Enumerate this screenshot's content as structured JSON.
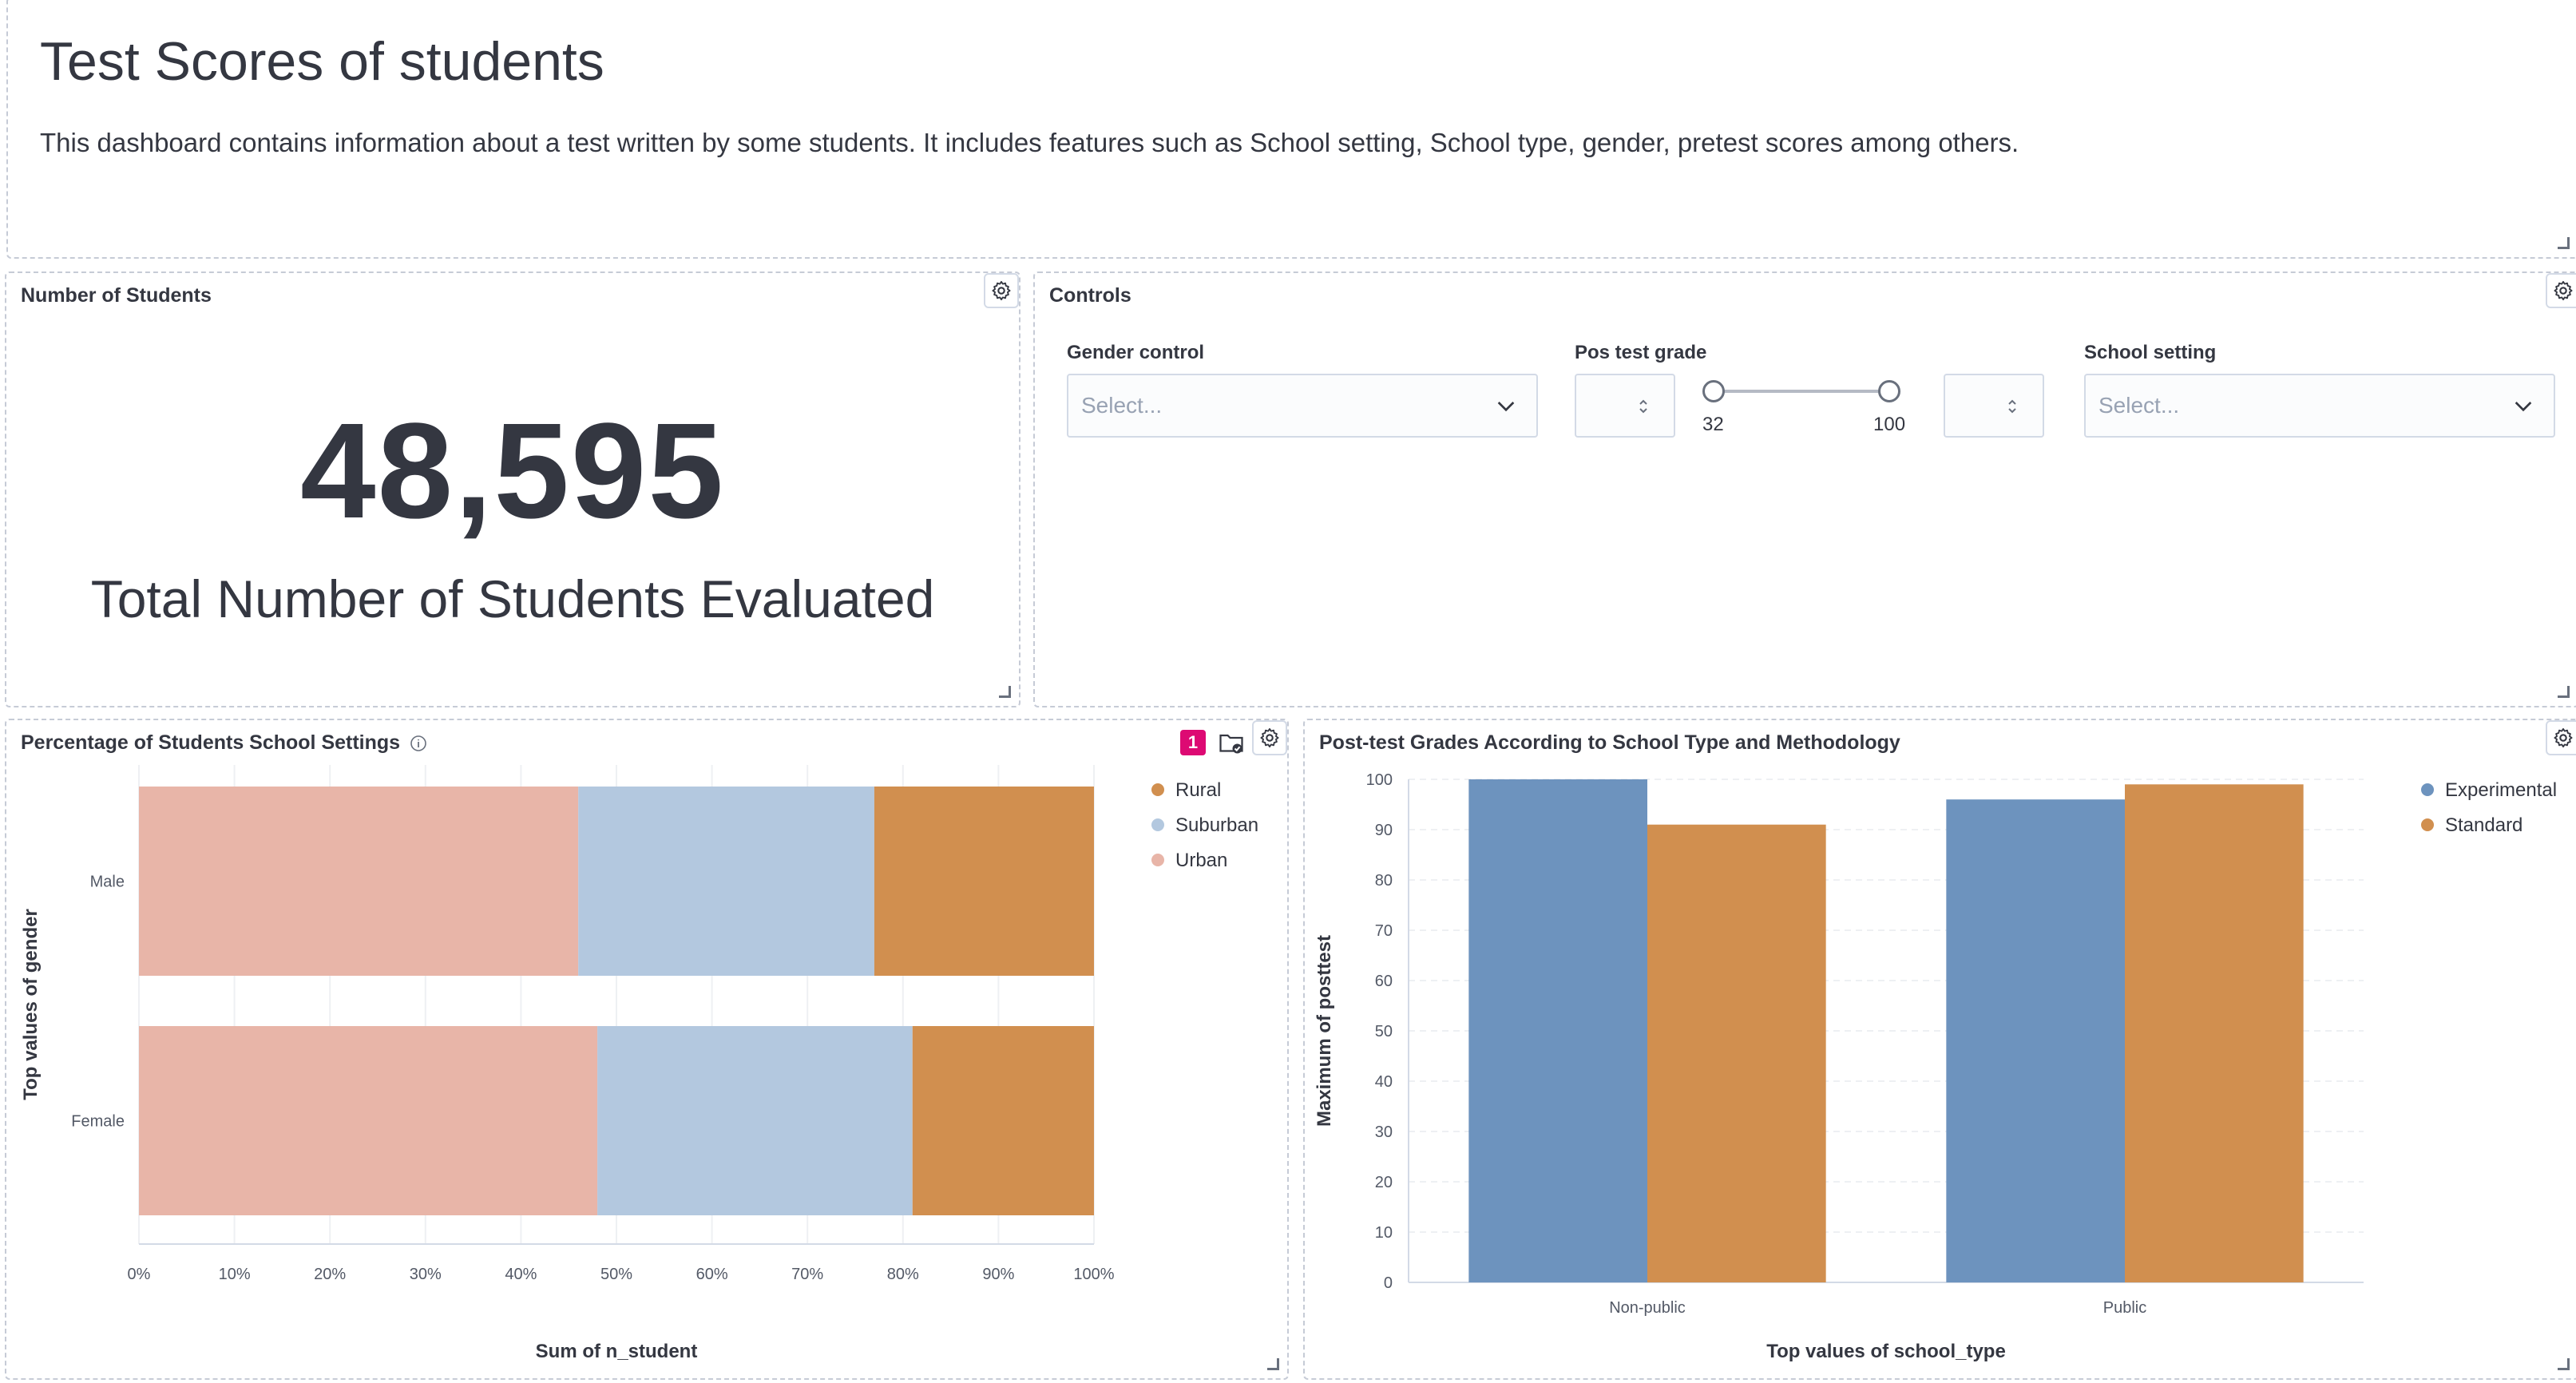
{
  "markdown": {
    "title": "Test Scores of students",
    "description": "This dashboard contains information about a test written by some students. It includes features such as School setting, School type, gender, pretest scores among others."
  },
  "metric_panel": {
    "title": "Number of Students",
    "value": "48,595",
    "label": "Total Number of Students Evaluated",
    "icon": "gear-icon"
  },
  "controls_panel": {
    "title": "Controls",
    "gender": {
      "label": "Gender control",
      "placeholder": "Select..."
    },
    "pos_test": {
      "label": "Pos test grade",
      "min": 32,
      "max": 100,
      "min_label": "32",
      "max_label": "100"
    },
    "school_setting": {
      "label": "School setting",
      "placeholder": "Select..."
    }
  },
  "pct_panel": {
    "title": "Percentage of Students School Settings",
    "badge": "1",
    "legend": [
      {
        "name": "Rural",
        "color": "#d18f4f"
      },
      {
        "name": "Suburban",
        "color": "#b3c8df"
      },
      {
        "name": "Urban",
        "color": "#e8b5a8"
      }
    ]
  },
  "post_panel": {
    "title": "Post-test Grades According to School Type and Methodology",
    "legend": [
      {
        "name": "Experimental",
        "color": "#6d93be"
      },
      {
        "name": "Standard",
        "color": "#d18f4f"
      }
    ]
  },
  "chart_data": [
    {
      "type": "bar",
      "orientation": "horizontal",
      "stacked": "percentage",
      "categories": [
        "Male",
        "Female"
      ],
      "series": [
        {
          "name": "Urban",
          "values": [
            46,
            48
          ],
          "color": "#e8b5a8"
        },
        {
          "name": "Suburban",
          "values": [
            31,
            33
          ],
          "color": "#b3c8df"
        },
        {
          "name": "Rural",
          "values": [
            23,
            19
          ],
          "color": "#d18f4f"
        }
      ],
      "xticks": [
        "0%",
        "10%",
        "20%",
        "30%",
        "40%",
        "50%",
        "60%",
        "70%",
        "80%",
        "90%",
        "100%"
      ],
      "xlabel": "Sum of n_student",
      "ylabel": "Top values of gender",
      "xlim": [
        0,
        100
      ],
      "grid": true,
      "legend_position": "right"
    },
    {
      "type": "bar",
      "orientation": "vertical",
      "categories": [
        "Non-public",
        "Public"
      ],
      "series": [
        {
          "name": "Experimental",
          "values": [
            100,
            96
          ],
          "color": "#6d93be"
        },
        {
          "name": "Standard",
          "values": [
            91,
            99
          ],
          "color": "#d18f4f"
        }
      ],
      "yticks": [
        "0",
        "10",
        "20",
        "30",
        "40",
        "50",
        "60",
        "70",
        "80",
        "90",
        "100"
      ],
      "xlabel": "Top values of school_type",
      "ylabel": "Maximum of posttest",
      "ylim": [
        0,
        100
      ],
      "grid": true,
      "legend_position": "right"
    }
  ]
}
